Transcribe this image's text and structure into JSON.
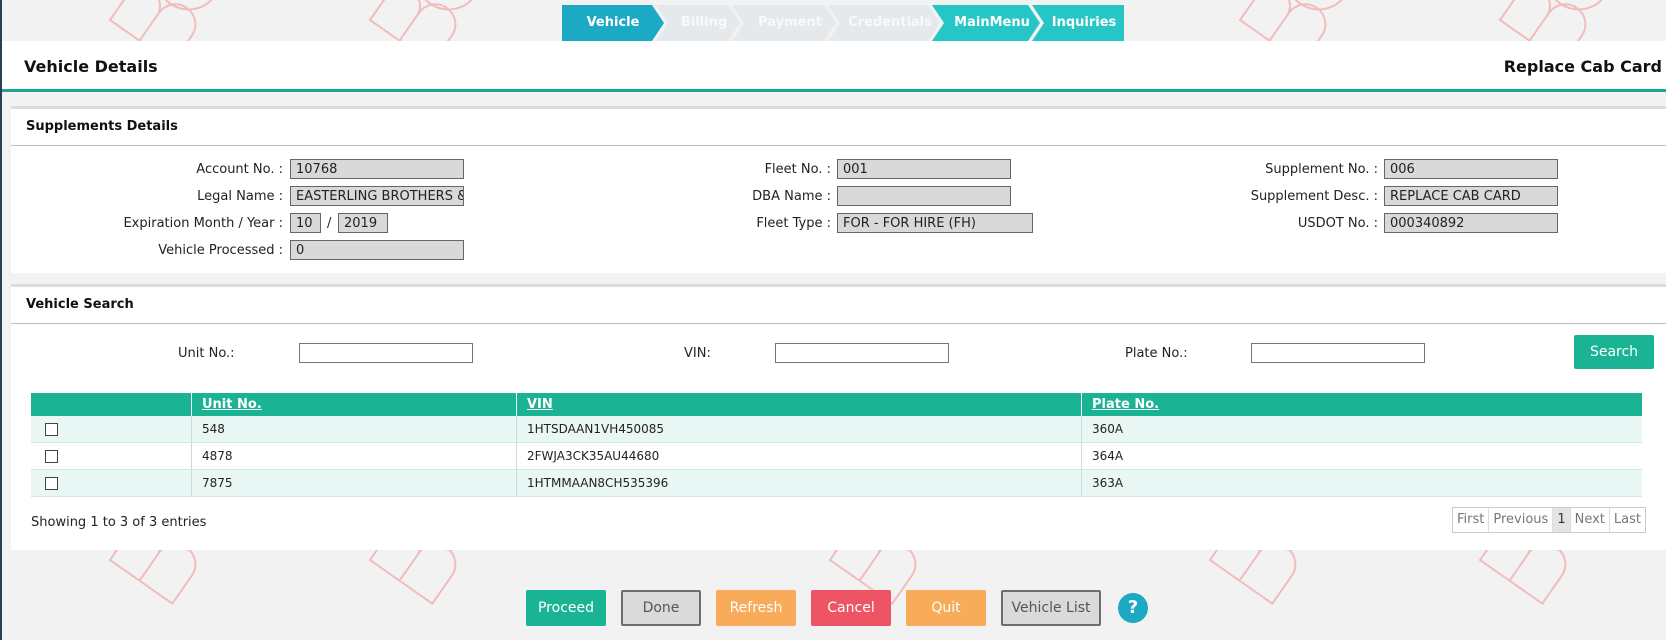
{
  "wizard": {
    "steps": [
      "Vehicle",
      "Billing",
      "Payment",
      "Credentials",
      "MainMenu",
      "Inquiries"
    ]
  },
  "header": {
    "title": "Vehicle Details",
    "transaction": "Replace Cab Card"
  },
  "supplements": {
    "heading": "Supplements Details",
    "account_label": "Account No. :",
    "account_value": "10768",
    "legal_label": "Legal Name :",
    "legal_value": "EASTERLING BROTHERS & S",
    "exp_label": "Expiration Month / Year :",
    "exp_month": "10",
    "exp_sep": "/",
    "exp_year": "2019",
    "processed_label": "Vehicle Processed :",
    "processed_value": "0",
    "fleet_label": "Fleet No. :",
    "fleet_value": "001",
    "dba_label": "DBA Name :",
    "dba_value": "",
    "fleet_type_label": "Fleet Type :",
    "fleet_type_value": "FOR - FOR HIRE (FH)",
    "supp_no_label": "Supplement No. :",
    "supp_no_value": "006",
    "supp_desc_label": "Supplement Desc. :",
    "supp_desc_value": "REPLACE CAB CARD",
    "usdot_label": "USDOT No. :",
    "usdot_value": "000340892"
  },
  "search": {
    "heading": "Vehicle Search",
    "unit_label": "Unit No.:",
    "vin_label": "VIN:",
    "plate_label": "Plate No.:",
    "button": "Search"
  },
  "table": {
    "columns": [
      "",
      "Unit No.",
      "VIN",
      "Plate No."
    ],
    "rows": [
      {
        "unit": "548",
        "vin": "1HTSDAAN1VH450085",
        "plate": "360A"
      },
      {
        "unit": "4878",
        "vin": "2FWJA3CK35AU44680",
        "plate": "364A"
      },
      {
        "unit": "7875",
        "vin": "1HTMMAAN8CH535396",
        "plate": "363A"
      }
    ],
    "showing": "Showing 1 to 3 of 3 entries",
    "pager": {
      "first": "First",
      "previous": "Previous",
      "page": "1",
      "next": "Next",
      "last": "Last"
    }
  },
  "actions": {
    "proceed": "Proceed",
    "done": "Done",
    "refresh": "Refresh",
    "cancel": "Cancel",
    "quit": "Quit",
    "vehicle_list": "Vehicle List",
    "help": "?"
  },
  "colors": {
    "accent_teal": "#1ab394",
    "step_active": "#1ba9c3",
    "step_done": "#26c6c6",
    "cancel_red": "#ed5565",
    "warning_orange": "#f8ac59"
  }
}
